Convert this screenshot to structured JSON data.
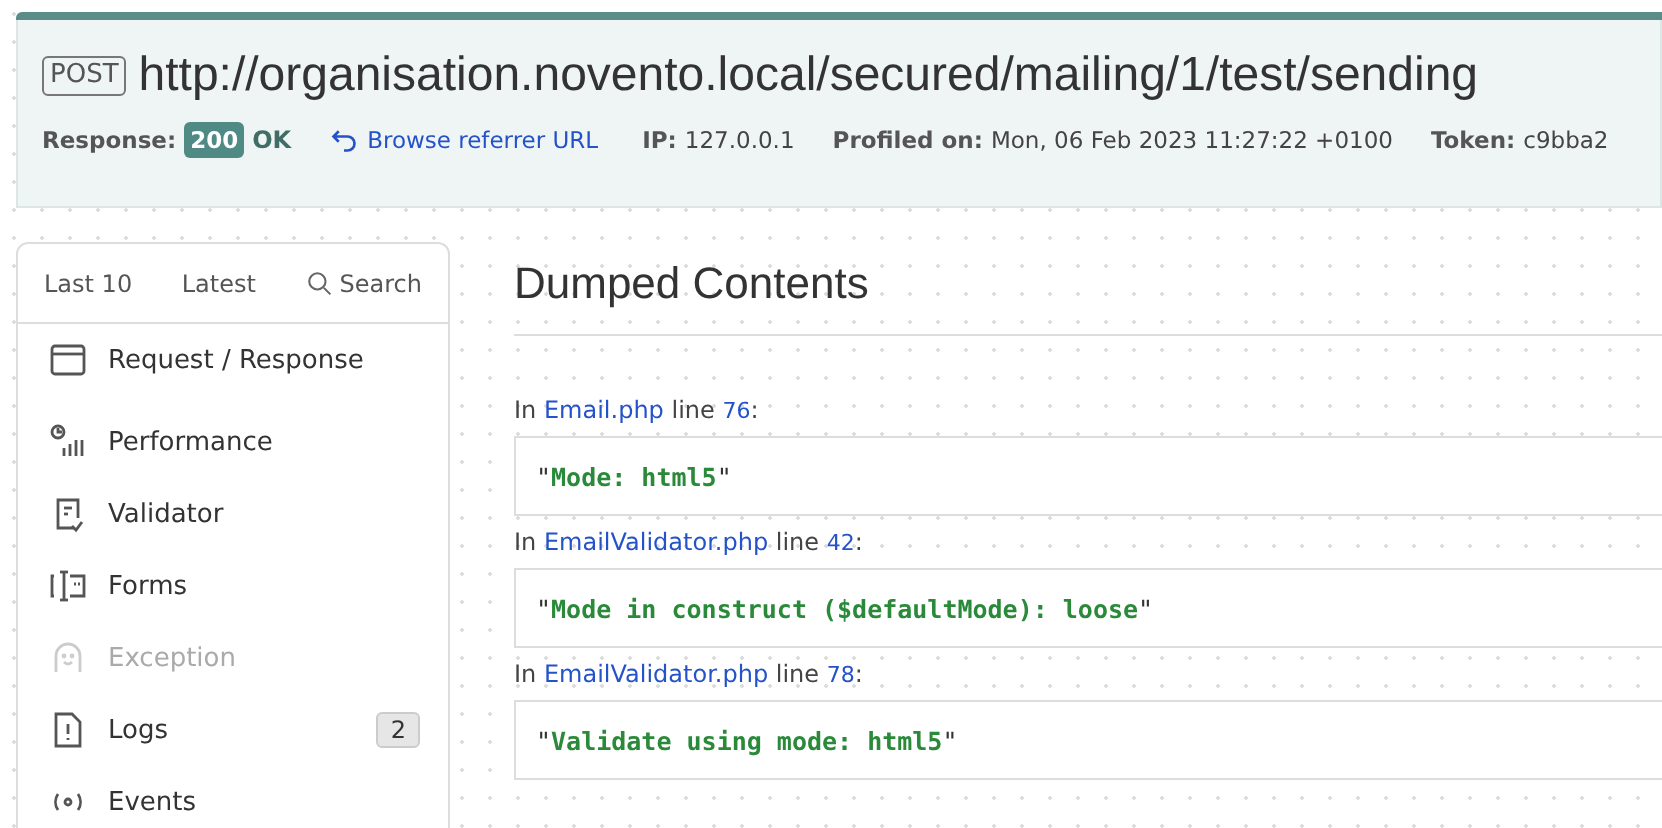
{
  "request": {
    "method": "POST",
    "url": "http://organisation.novento.local/secured/mailing/1/test/sending"
  },
  "meta": {
    "response_label": "Response:",
    "status_code": "200",
    "status_text": "OK",
    "referrer_link": "Browse referrer URL",
    "ip_label": "IP:",
    "ip": "127.0.0.1",
    "profiled_label": "Profiled on:",
    "profiled_on": "Mon, 06 Feb 2023 11:27:22 +0100",
    "token_label": "Token:",
    "token": "c9bba2"
  },
  "sidebar": {
    "tabs": [
      {
        "label": "Last 10",
        "kind": "text"
      },
      {
        "label": "Latest",
        "kind": "text"
      },
      {
        "label": "Search",
        "kind": "search"
      }
    ],
    "items": [
      {
        "label": "Request / Response",
        "kind": "window",
        "disabled": false
      },
      {
        "label": "Performance",
        "kind": "chart",
        "disabled": false
      },
      {
        "label": "Validator",
        "kind": "check",
        "disabled": false
      },
      {
        "label": "Forms",
        "kind": "form",
        "disabled": false
      },
      {
        "label": "Exception",
        "kind": "ghost",
        "disabled": true
      },
      {
        "label": "Logs",
        "kind": "file",
        "disabled": false,
        "count": "2"
      },
      {
        "label": "Events",
        "kind": "signal",
        "disabled": false
      }
    ]
  },
  "main": {
    "title": "Dumped Contents",
    "dumps": [
      {
        "prefix": "In",
        "file": "Email.php",
        "line_word": "line",
        "line": "76",
        "suffix": ":",
        "value": "\"Mode: html5\""
      },
      {
        "prefix": "In",
        "file": "EmailValidator.php",
        "line_word": "line",
        "line": "42",
        "suffix": ":",
        "value": "\"Mode in construct ($defaultMode): loose\""
      },
      {
        "prefix": "In",
        "file": "EmailValidator.php",
        "line_word": "line",
        "line": "78",
        "suffix": ":",
        "value": "\"Validate using mode: html5\""
      }
    ]
  }
}
